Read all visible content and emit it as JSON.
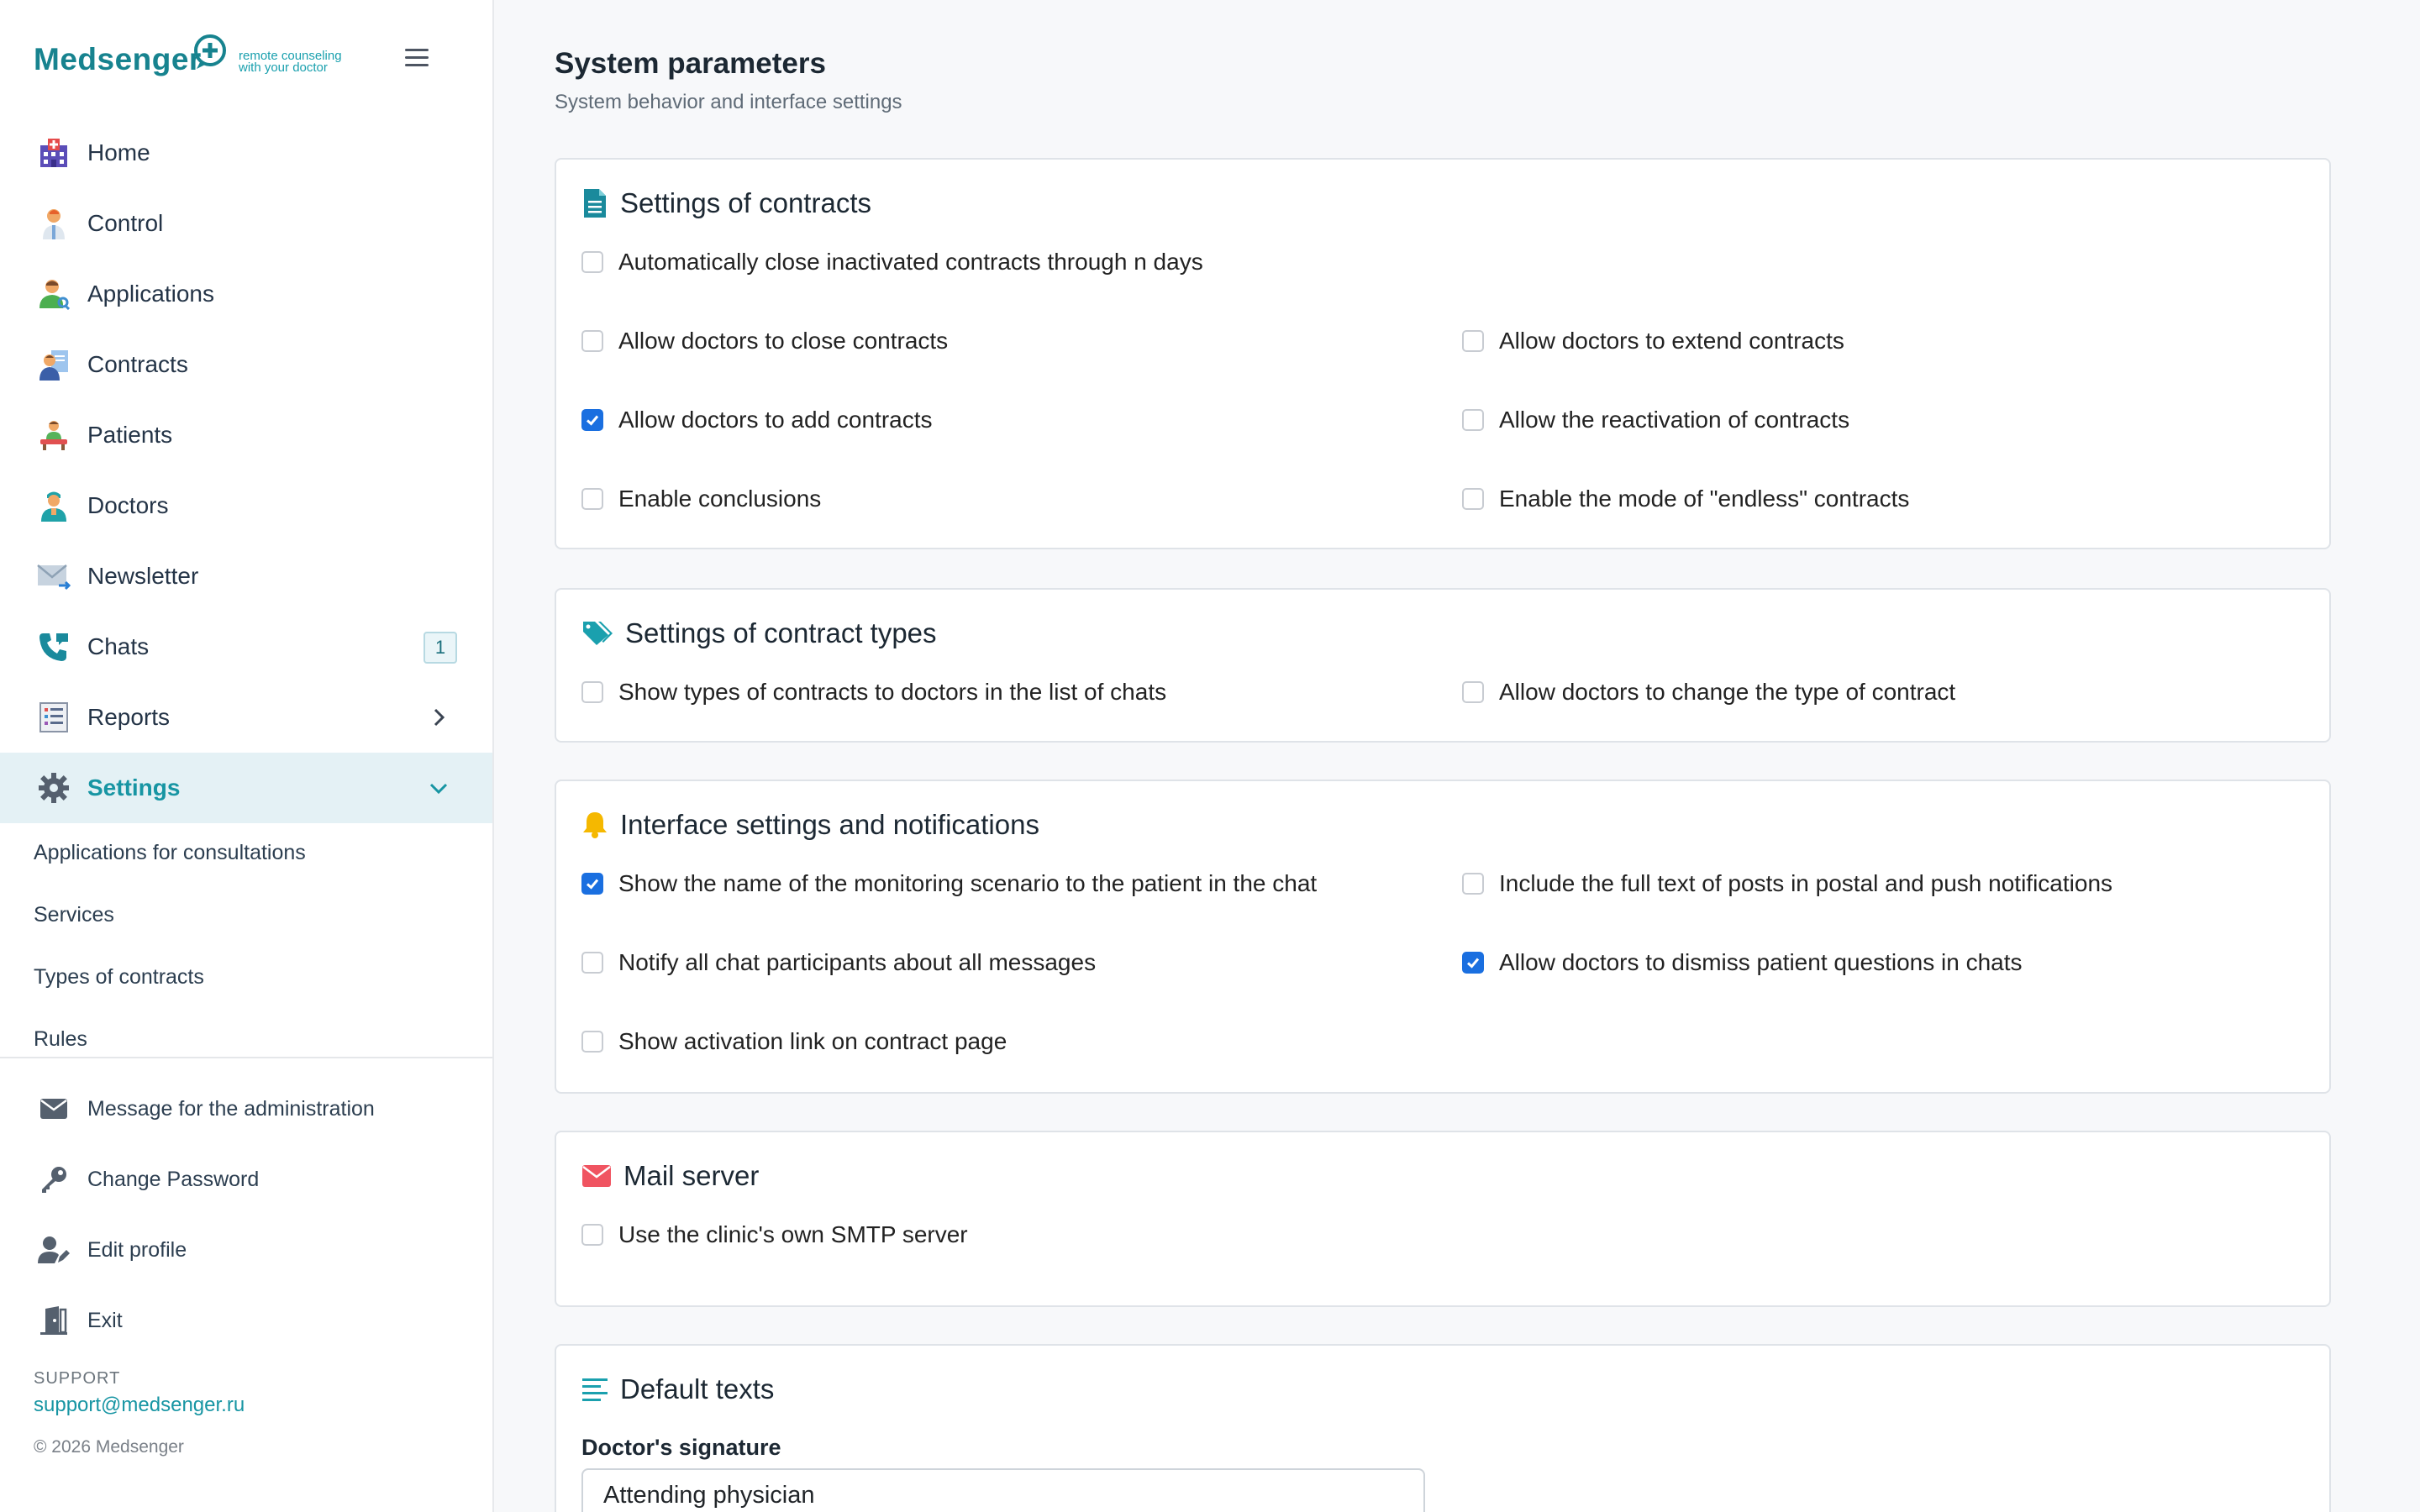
{
  "brand": {
    "name": "Medsenger",
    "tagline_line1": "remote counseling",
    "tagline_line2": "with your doctor"
  },
  "sidebar": {
    "items": [
      {
        "label": "Home",
        "icon": "hospital-icon"
      },
      {
        "label": "Control",
        "icon": "doctor-icon"
      },
      {
        "label": "Applications",
        "icon": "user-search-icon"
      },
      {
        "label": "Contracts",
        "icon": "contract-user-icon"
      },
      {
        "label": "Patients",
        "icon": "patient-icon"
      },
      {
        "label": "Doctors",
        "icon": "nurse-icon"
      },
      {
        "label": "Newsletter",
        "icon": "mail-icon"
      },
      {
        "label": "Chats",
        "icon": "phone-icon",
        "badge": "1"
      },
      {
        "label": "Reports",
        "icon": "report-icon"
      },
      {
        "label": "Settings",
        "icon": "gear-icon"
      }
    ],
    "sub_items": [
      {
        "label": "Applications for consultations"
      },
      {
        "label": "Services"
      },
      {
        "label": "Types of contracts"
      },
      {
        "label": "Rules"
      }
    ],
    "actions": [
      {
        "label": "Message for the administration",
        "icon": "envelope-icon"
      },
      {
        "label": "Change Password",
        "icon": "key-icon"
      },
      {
        "label": "Edit profile",
        "icon": "user-edit-icon"
      },
      {
        "label": "Exit",
        "icon": "door-exit-icon"
      }
    ],
    "support_title": "SUPPORT",
    "support_email": "support@medsenger.ru",
    "copyright": "© 2026 Medsenger"
  },
  "page": {
    "title": "System parameters",
    "subtitle": "System behavior and interface settings"
  },
  "sections": {
    "contracts": {
      "title": "Settings of contracts",
      "options": [
        {
          "label": "Automatically close inactivated contracts through n days",
          "checked": false
        },
        {
          "label": "Allow doctors to close contracts",
          "checked": false
        },
        {
          "label": "Allow doctors to extend contracts",
          "checked": false
        },
        {
          "label": "Allow doctors to add contracts",
          "checked": true
        },
        {
          "label": "Allow the reactivation of contracts",
          "checked": false
        },
        {
          "label": "Enable conclusions",
          "checked": false
        },
        {
          "label": "Enable the mode of \"endless\" contracts",
          "checked": false
        }
      ]
    },
    "contract_types": {
      "title": "Settings of contract types",
      "options": [
        {
          "label": "Show types of contracts to doctors in the list of chats",
          "checked": false
        },
        {
          "label": "Allow doctors to change the type of contract",
          "checked": false
        }
      ]
    },
    "interface": {
      "title": "Interface settings and notifications",
      "options": [
        {
          "label": "Show the name of the monitoring scenario to the patient in the chat",
          "checked": true
        },
        {
          "label": "Include the full text of posts in postal and push notifications",
          "checked": false
        },
        {
          "label": "Notify all chat participants about all messages",
          "checked": false
        },
        {
          "label": "Allow doctors to dismiss patient questions in chats",
          "checked": true
        },
        {
          "label": "Show activation link on contract page",
          "checked": false
        }
      ]
    },
    "mail": {
      "title": "Mail server",
      "options": [
        {
          "label": "Use the clinic's own SMTP server",
          "checked": false
        }
      ]
    },
    "default_texts": {
      "title": "Default texts",
      "signature_label": "Doctor's signature",
      "signature_value": "Attending physician"
    }
  },
  "colors": {
    "accent": "#1795a3",
    "checkbox_on": "#1a6fe0",
    "active_nav_bg": "#e4f1f5"
  }
}
